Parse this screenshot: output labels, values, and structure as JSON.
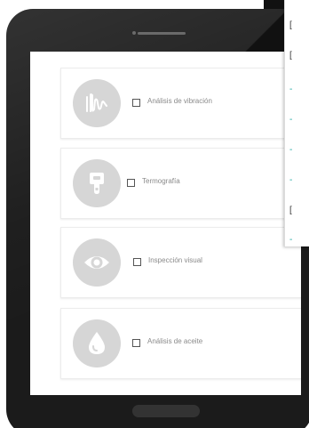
{
  "services": [
    {
      "label": "Análisis de vibración",
      "icon": "vibration-wave-icon",
      "checked": false
    },
    {
      "label": "Termografía",
      "icon": "thermal-camera-icon",
      "checked": false
    },
    {
      "label": "Inspección visual",
      "icon": "eye-icon",
      "checked": false
    },
    {
      "label": "Análisis de aceite",
      "icon": "oil-drop-icon",
      "checked": false
    }
  ],
  "side_panel": {
    "items": [
      {
        "text": "[",
        "style": "dark"
      },
      {
        "text": "[",
        "style": "dark"
      },
      {
        "text": "-",
        "style": "teal"
      },
      {
        "text": "-",
        "style": "teal"
      },
      {
        "text": "-",
        "style": "teal"
      },
      {
        "text": "-",
        "style": "teal"
      },
      {
        "text": "[",
        "style": "dark"
      },
      {
        "text": "-",
        "style": "teal"
      }
    ]
  },
  "colors": {
    "tablet_body": "#1b1b1b",
    "icon_circle": "#d6d6d6",
    "label_text": "#8a8a8a",
    "accent_teal": "#17a6a0"
  }
}
